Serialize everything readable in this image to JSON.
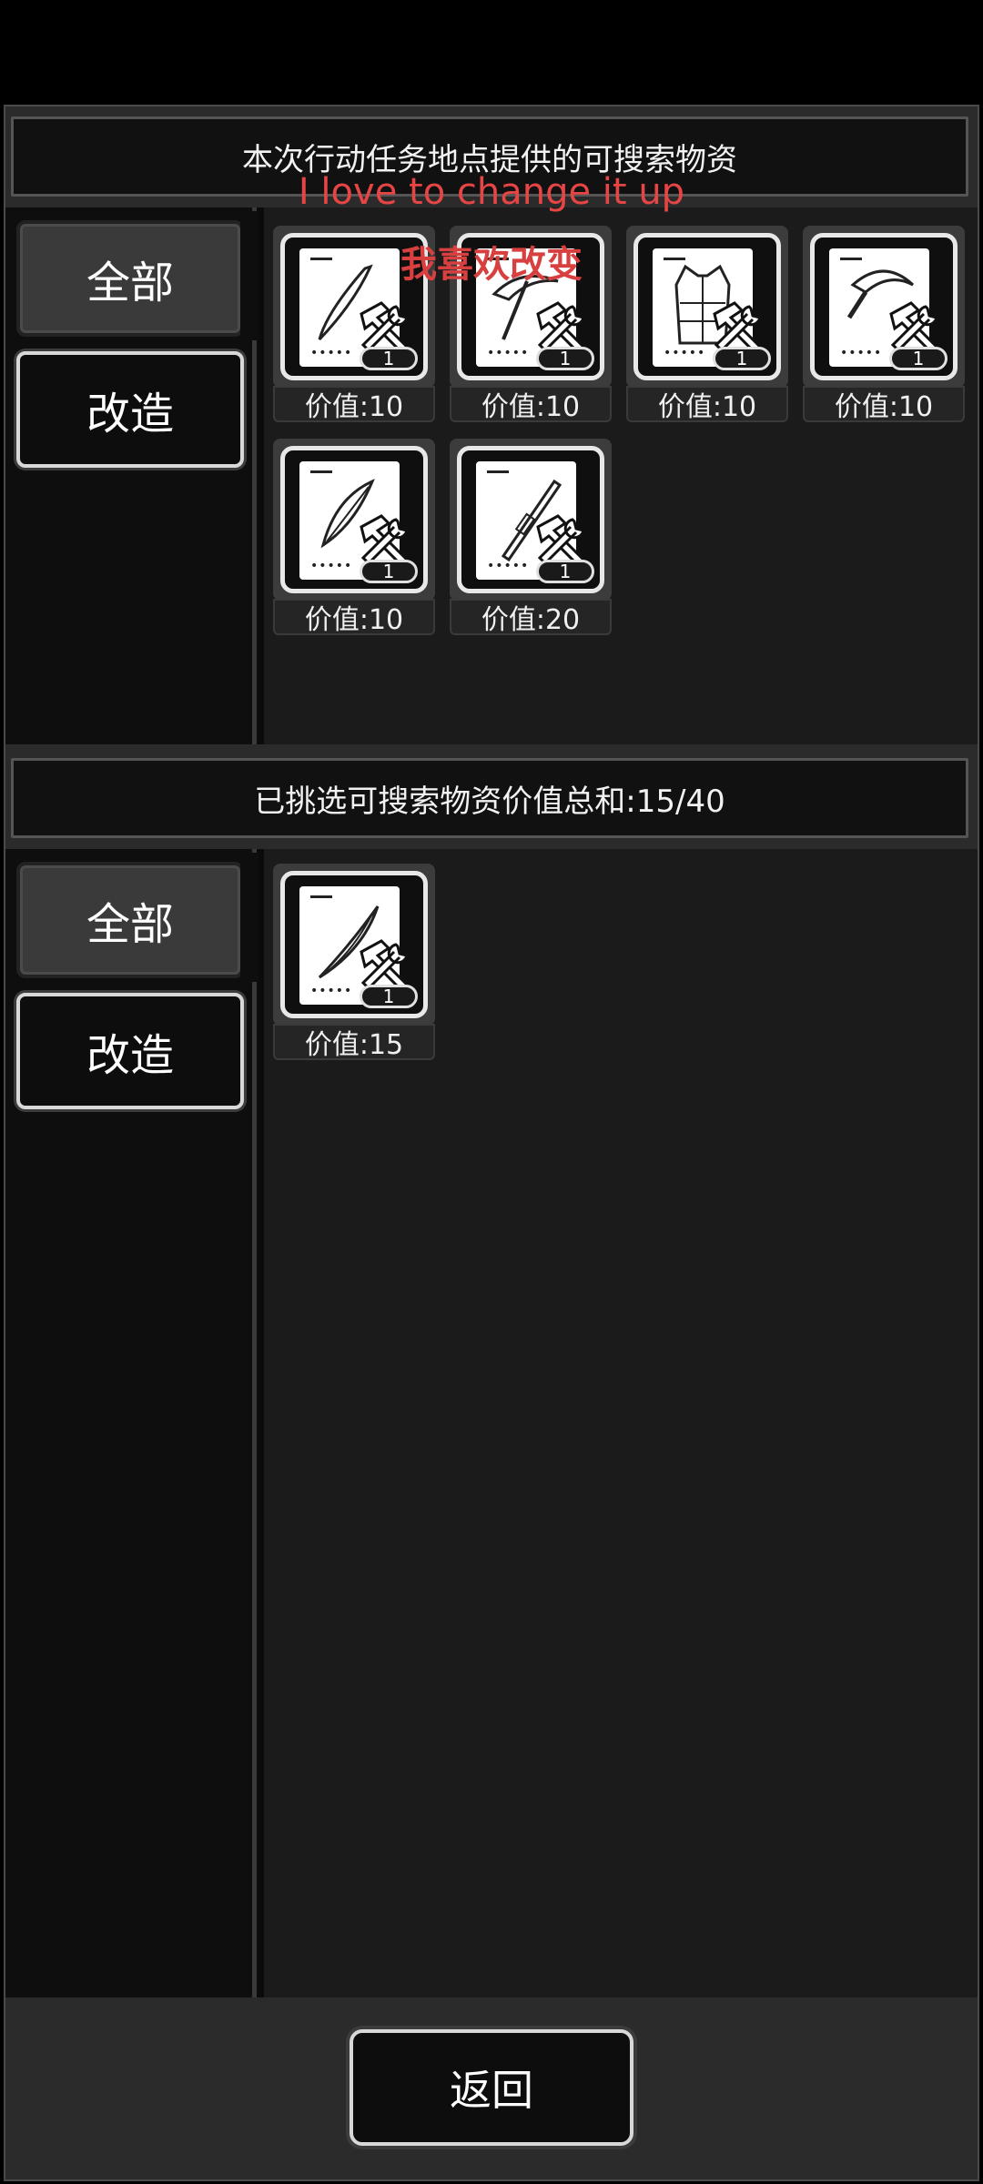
{
  "top_section": {
    "title": "本次行动任务地点提供的可搜索物资",
    "tabs": {
      "all": "全部",
      "modify": "改造"
    },
    "items": [
      {
        "icon": "curved-blade-blueprint-icon",
        "count": "1",
        "value": "价值:10"
      },
      {
        "icon": "pickaxe-blueprint-icon",
        "count": "1",
        "value": "价值:10"
      },
      {
        "icon": "vest-blueprint-icon",
        "count": "1",
        "value": "价值:10"
      },
      {
        "icon": "sickle-blueprint-icon",
        "count": "1",
        "value": "价值:10"
      },
      {
        "icon": "leaf-blade-blueprint-icon",
        "count": "1",
        "value": "价值:10"
      },
      {
        "icon": "rifle-blueprint-icon",
        "count": "1",
        "value": "价值:20"
      }
    ]
  },
  "overlay": {
    "english": "I love to change it up",
    "chinese": "我喜欢改变"
  },
  "bottom_section": {
    "title": "已挑选可搜索物资价值总和:15/40",
    "tabs": {
      "all": "全部",
      "modify": "改造"
    },
    "items": [
      {
        "icon": "long-blade-blueprint-icon",
        "count": "1",
        "value": "价值:15"
      }
    ]
  },
  "footer": {
    "back_label": "返回"
  },
  "colors": {
    "background": "#0b0b0b",
    "accent_text": "#e64545",
    "border_light": "#e8e8e8"
  }
}
